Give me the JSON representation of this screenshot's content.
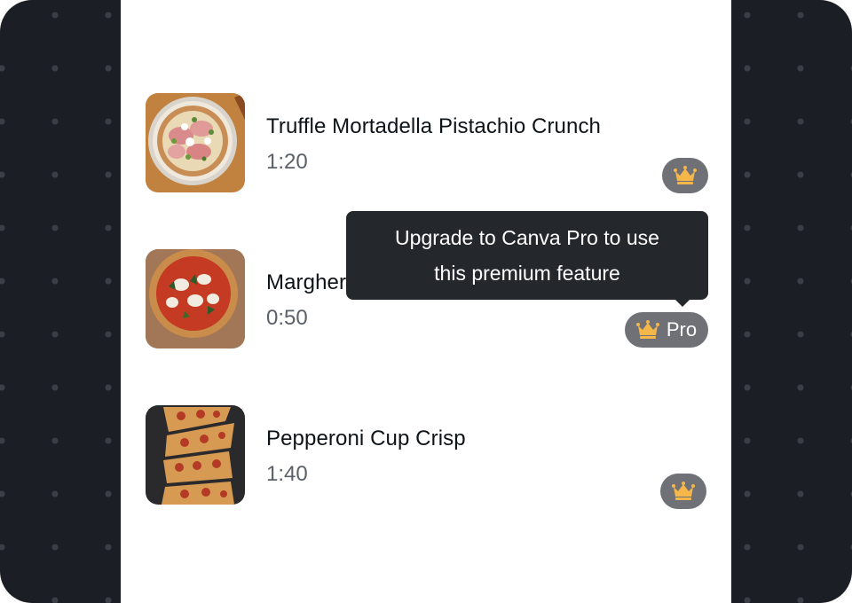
{
  "colors": {
    "background": "#1b1e24",
    "panel": "#ffffff",
    "badge": "#6f7176",
    "crown": "#f5b64a",
    "tooltip": "#24272c"
  },
  "items": [
    {
      "title": "Truffle Mortadella Pistachio Crunch",
      "duration": "1:20",
      "thumb_icon": "pizza-mortadella-image",
      "badge_icon": "crown-icon"
    },
    {
      "title": "Margherita",
      "duration": "0:50",
      "thumb_icon": "pizza-margherita-image",
      "badge_icon": "crown-icon",
      "badge_label": "Pro"
    },
    {
      "title": "Pepperoni Cup Crisp",
      "duration": "1:40",
      "thumb_icon": "pizza-pepperoni-image",
      "badge_icon": "crown-icon"
    }
  ],
  "tooltip": {
    "line1": "Upgrade to Canva Pro to use",
    "line2": "this premium feature"
  }
}
